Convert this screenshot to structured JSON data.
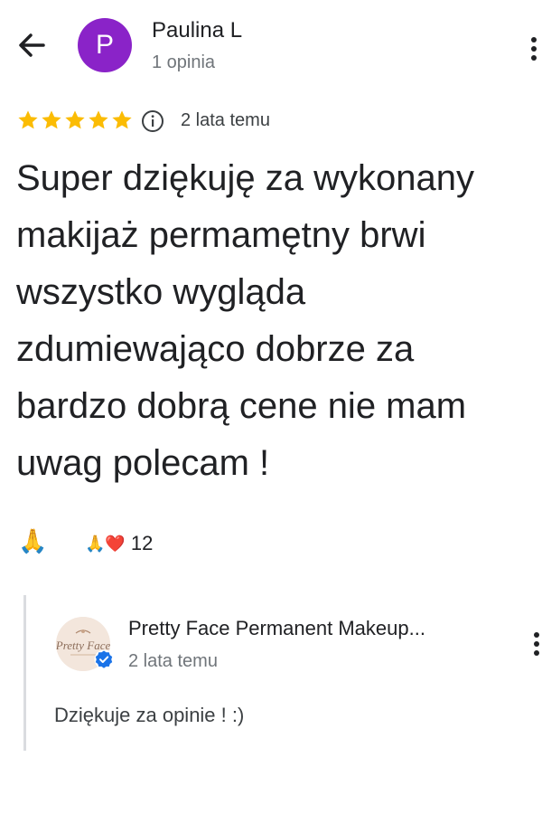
{
  "header": {
    "avatar_letter": "P",
    "avatar_color": "#8a23c8",
    "reviewer_name": "Paulina L",
    "review_count": "1 opinia",
    "icons": [
      "back-arrow-icon",
      "more-vert-icon"
    ]
  },
  "review": {
    "rating": 5,
    "max_rating": 5,
    "star_color": "#fbbc04",
    "date": "2 lata temu",
    "text": "Super dziękuję za wykonany makijaż permamętny brwi wszystko wygląda zdumiewająco dobrze za bardzo dobrą cene nie mam uwag polecam !"
  },
  "reactions": {
    "primary_emoji": "🙏",
    "summary_emojis": "🙏❤️",
    "count": "12"
  },
  "owner_reply": {
    "owner_name": "Pretty Face Permanent Makeup...",
    "logo_text": "Pretty Face",
    "date": "2 lata temu",
    "text": "Dziękuje za opinie ! :)",
    "verified_color": "#1a73e8"
  }
}
